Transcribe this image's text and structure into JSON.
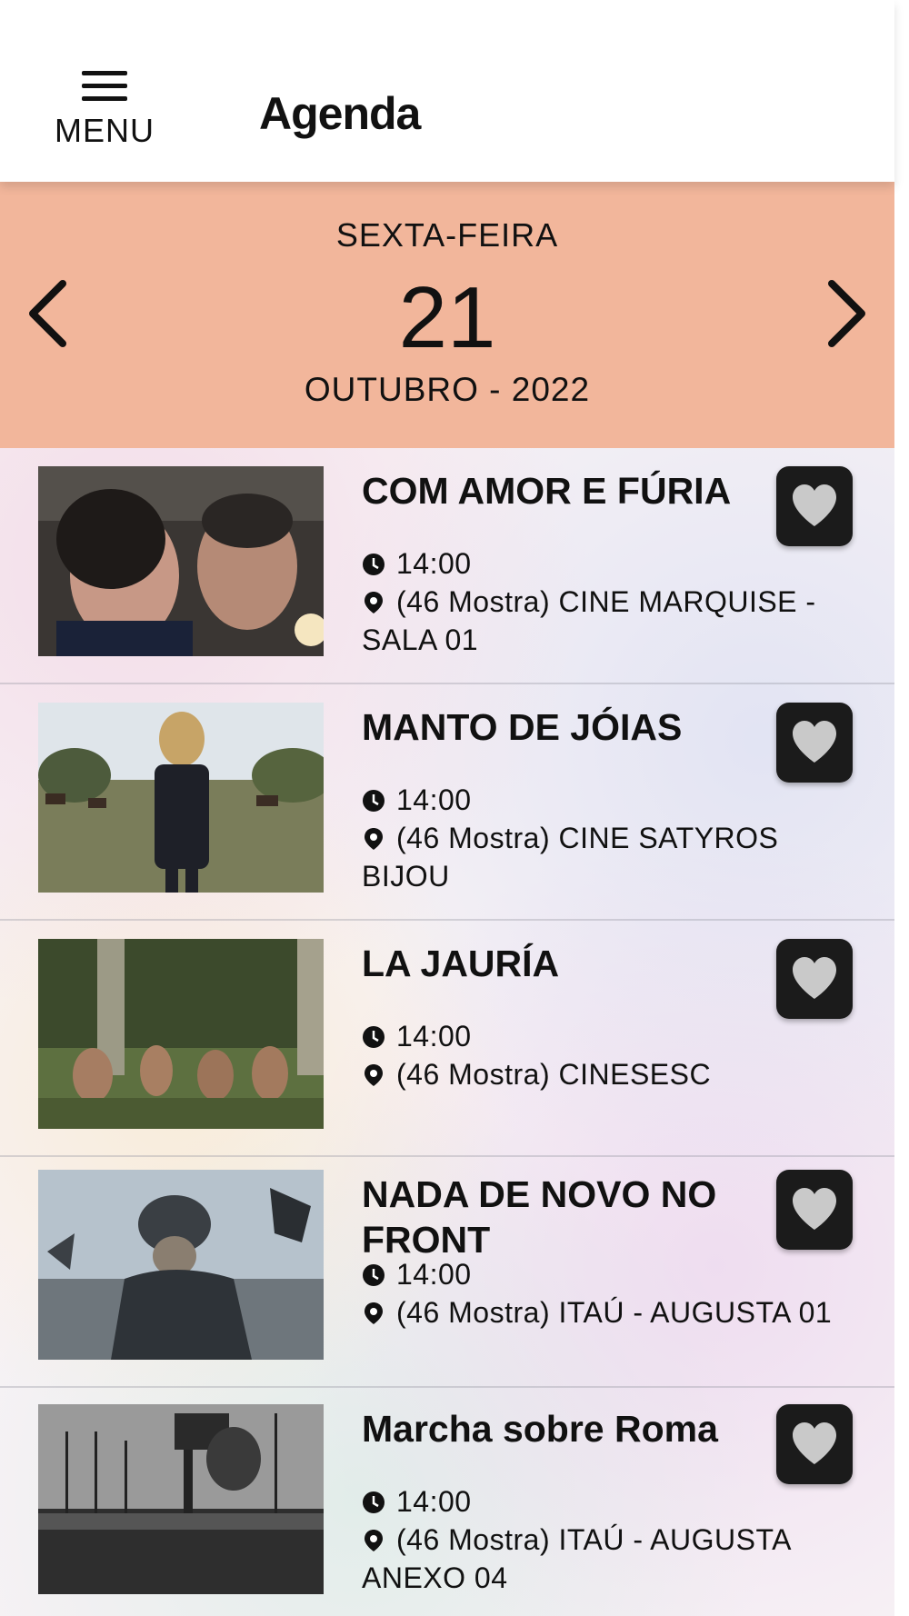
{
  "header": {
    "menu_label": "MENU",
    "title": "Agenda"
  },
  "date": {
    "weekday": "SEXTA-FEIRA",
    "day": "21",
    "month_year": "OUTUBRO - 2022"
  },
  "colors": {
    "date_bar": "#f2b69b",
    "fav_button": "#1b1b1b",
    "heart": "#c9c9c9"
  },
  "events": [
    {
      "title": "COM AMOR E FÚRIA",
      "time": "14:00",
      "location": "(46 Mostra) CINE MARQUISE - SALA 01"
    },
    {
      "title": "MANTO DE JÓIAS",
      "time": "14:00",
      "location": "(46 Mostra) CINE SATYROS BIJOU"
    },
    {
      "title": "LA JAURÍA",
      "time": "14:00",
      "location": "(46 Mostra) CINESESC"
    },
    {
      "title": "NADA DE NOVO NO FRONT",
      "time": "14:00",
      "location": "(46 Mostra) ITAÚ - AUGUSTA 01"
    },
    {
      "title": "Marcha sobre Roma",
      "time": "14:00",
      "location": "(46 Mostra) ITAÚ - AUGUSTA ANEXO 04"
    }
  ]
}
